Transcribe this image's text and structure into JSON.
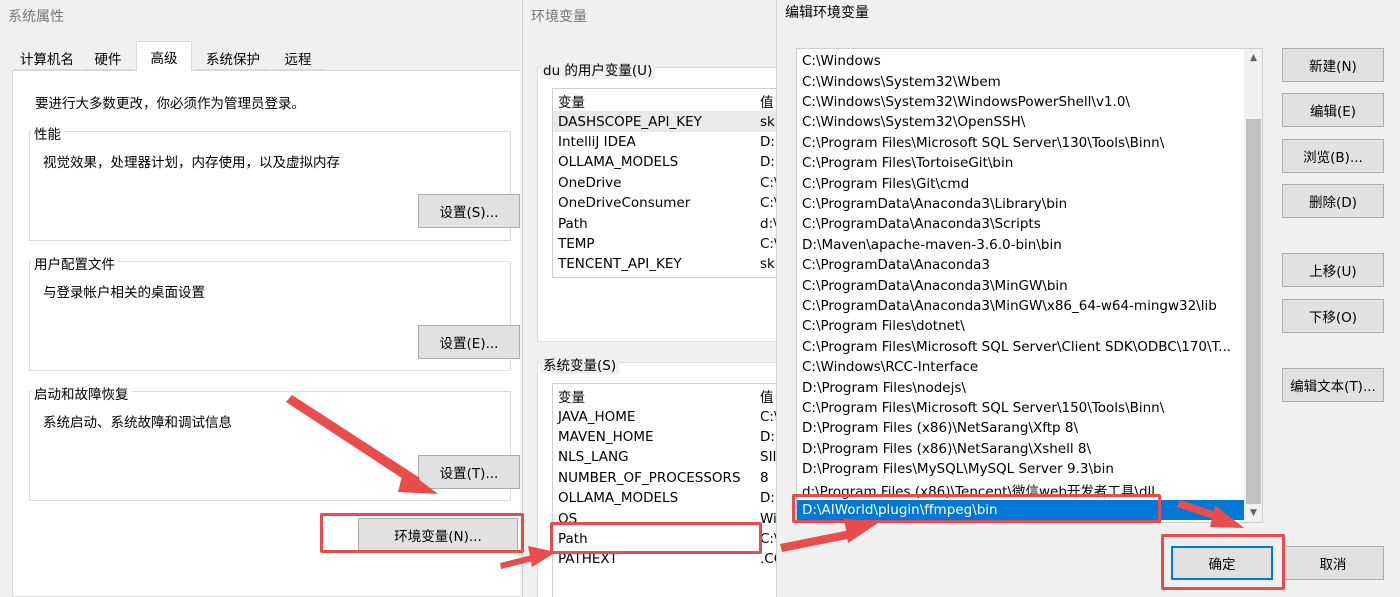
{
  "system_properties": {
    "title": "系统属性",
    "tabs": [
      "计算机名",
      "硬件",
      "高级",
      "系统保护",
      "远程"
    ],
    "active_tab": "高级",
    "admin_notice": "要进行大多数更改，你必须作为管理员登录。",
    "performance": {
      "label": "性能",
      "desc": "视觉效果，处理器计划，内存使用，以及虚拟内存",
      "button": "设置(S)..."
    },
    "user_profile": {
      "label": "用户配置文件",
      "desc": "与登录帐户相关的桌面设置",
      "button": "设置(E)..."
    },
    "startup": {
      "label": "启动和故障恢复",
      "desc": "系统启动、系统故障和调试信息",
      "button": "设置(T)..."
    },
    "env_button": "环境变量(N)..."
  },
  "env_vars": {
    "title": "环境变量",
    "user_label": "du 的用户变量(U)",
    "header_name": "变量",
    "header_value": "值",
    "user_vars": [
      {
        "name": "DASHSCOPE_API_KEY",
        "value": "sk"
      },
      {
        "name": "IntelliJ IDEA",
        "value": "D:"
      },
      {
        "name": "OLLAMA_MODELS",
        "value": "D:"
      },
      {
        "name": "OneDrive",
        "value": "C:\\"
      },
      {
        "name": "OneDriveConsumer",
        "value": "C:\\"
      },
      {
        "name": "Path",
        "value": "d:\\"
      },
      {
        "name": "TEMP",
        "value": "C:\\"
      },
      {
        "name": "TENCENT_API_KEY",
        "value": "sk"
      }
    ],
    "system_label": "系统变量(S)",
    "system_vars": [
      {
        "name": "JAVA_HOME",
        "value": "C:\\"
      },
      {
        "name": "MAVEN_HOME",
        "value": "D:"
      },
      {
        "name": "NLS_LANG",
        "value": "SII"
      },
      {
        "name": "NUMBER_OF_PROCESSORS",
        "value": "8"
      },
      {
        "name": "OLLAMA_MODELS",
        "value": "D:"
      },
      {
        "name": "OS",
        "value": "Wi"
      },
      {
        "name": "Path",
        "value": "C:\\"
      },
      {
        "name": "PATHEXT",
        "value": ".CO"
      }
    ]
  },
  "edit_env": {
    "title": "编辑环境变量",
    "paths": [
      "C:\\Windows",
      "C:\\Windows\\System32\\Wbem",
      "C:\\Windows\\System32\\WindowsPowerShell\\v1.0\\",
      "C:\\Windows\\System32\\OpenSSH\\",
      "C:\\Program Files\\Microsoft SQL Server\\130\\Tools\\Binn\\",
      "C:\\Program Files\\TortoiseGit\\bin",
      "C:\\Program Files\\Git\\cmd",
      "C:\\ProgramData\\Anaconda3\\Library\\bin",
      "C:\\ProgramData\\Anaconda3\\Scripts",
      "D:\\Maven\\apache-maven-3.6.0-bin\\bin",
      "C:\\ProgramData\\Anaconda3",
      "C:\\ProgramData\\Anaconda3\\MinGW\\bin",
      "C:\\ProgramData\\Anaconda3\\MinGW\\x86_64-w64-mingw32\\lib",
      "C:\\Program Files\\dotnet\\",
      "C:\\Program Files\\Microsoft SQL Server\\Client SDK\\ODBC\\170\\T...",
      "C:\\Windows\\RCC-Interface",
      "D:\\Program Files\\nodejs\\",
      "C:\\Program Files\\Microsoft SQL Server\\150\\Tools\\Binn\\",
      "D:\\Program Files (x86)\\NetSarang\\Xftp 8\\",
      "D:\\Program Files (x86)\\NetSarang\\Xshell 8\\",
      "D:\\Program Files\\MySQL\\MySQL Server 9.3\\bin",
      "d:\\Program Files (x86)\\Tencent\\微信web开发者工具\\dll",
      "D:\\AIWorld\\plugin\\ffmpeg\\bin"
    ],
    "selected_path": "D:\\AIWorld\\plugin\\ffmpeg\\bin",
    "buttons": {
      "new": "新建(N)",
      "edit": "编辑(E)",
      "browse": "浏览(B)...",
      "delete": "删除(D)",
      "move_up": "上移(U)",
      "move_down": "下移(O)",
      "edit_text": "编辑文本(T)...",
      "ok": "确定",
      "cancel": "取消"
    }
  },
  "annotation_color": "#e84c4c",
  "selection_color": "#0078d7"
}
